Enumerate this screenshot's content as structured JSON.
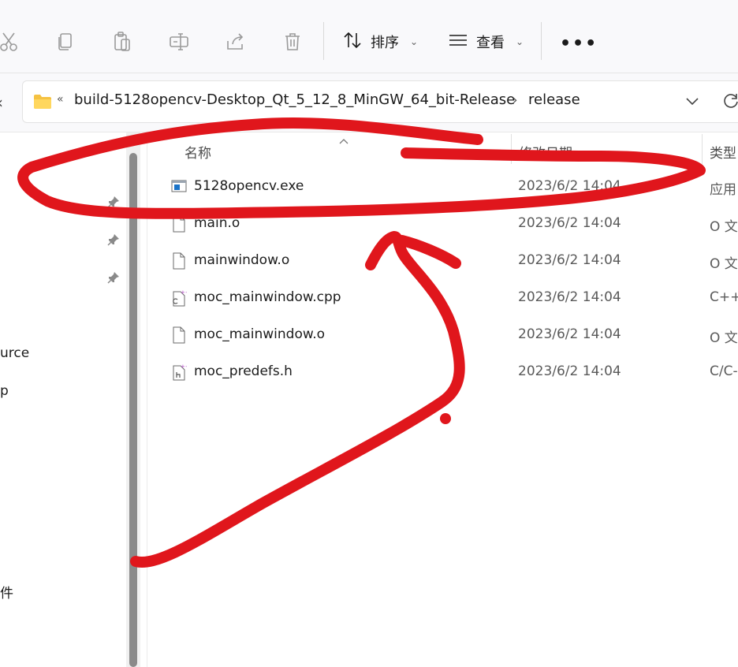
{
  "toolbar": {
    "sort_label": "排序",
    "view_label": "查看",
    "more_label": "•••"
  },
  "address": {
    "overflow_symbol": "«",
    "crumbs": [
      "build-5128opencv-Desktop_Qt_5_12_8_MinGW_64_bit-Release",
      "release"
    ],
    "separator": "›"
  },
  "nav": {
    "partial_items": [
      "urce",
      "p",
      "件"
    ]
  },
  "columns": {
    "name": "名称",
    "date": "修改日期",
    "type": "类型"
  },
  "files": [
    {
      "name": "5128opencv.exe",
      "date": "2023/6/2 14:04",
      "type": "应用",
      "icon": "exe-icon"
    },
    {
      "name": "main.o",
      "date": "2023/6/2 14:04",
      "type": "O 文",
      "icon": "file-icon"
    },
    {
      "name": "mainwindow.o",
      "date": "2023/6/2 14:04",
      "type": "O 文",
      "icon": "file-icon"
    },
    {
      "name": "moc_mainwindow.cpp",
      "date": "2023/6/2 14:04",
      "type": "C++",
      "icon": "cpp-file-icon"
    },
    {
      "name": "moc_mainwindow.o",
      "date": "2023/6/2 14:04",
      "type": "O 文",
      "icon": "file-icon"
    },
    {
      "name": "moc_predefs.h",
      "date": "2023/6/2 14:04",
      "type": "C/C-",
      "icon": "header-file-icon"
    }
  ],
  "colors": {
    "annotation": "#e0161c",
    "folder": "#f5c242",
    "scroll_thumb": "#8a8a8a"
  }
}
